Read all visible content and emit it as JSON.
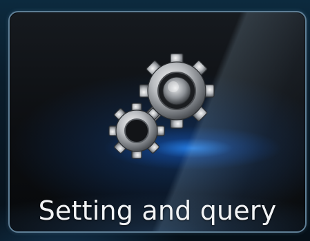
{
  "tile": {
    "label": "Setting and query",
    "icon": "gears-icon"
  },
  "colors": {
    "accent_glow": "#2a8cff",
    "tile_border": "#5f7f96",
    "label_text": "#f2f4f6"
  }
}
